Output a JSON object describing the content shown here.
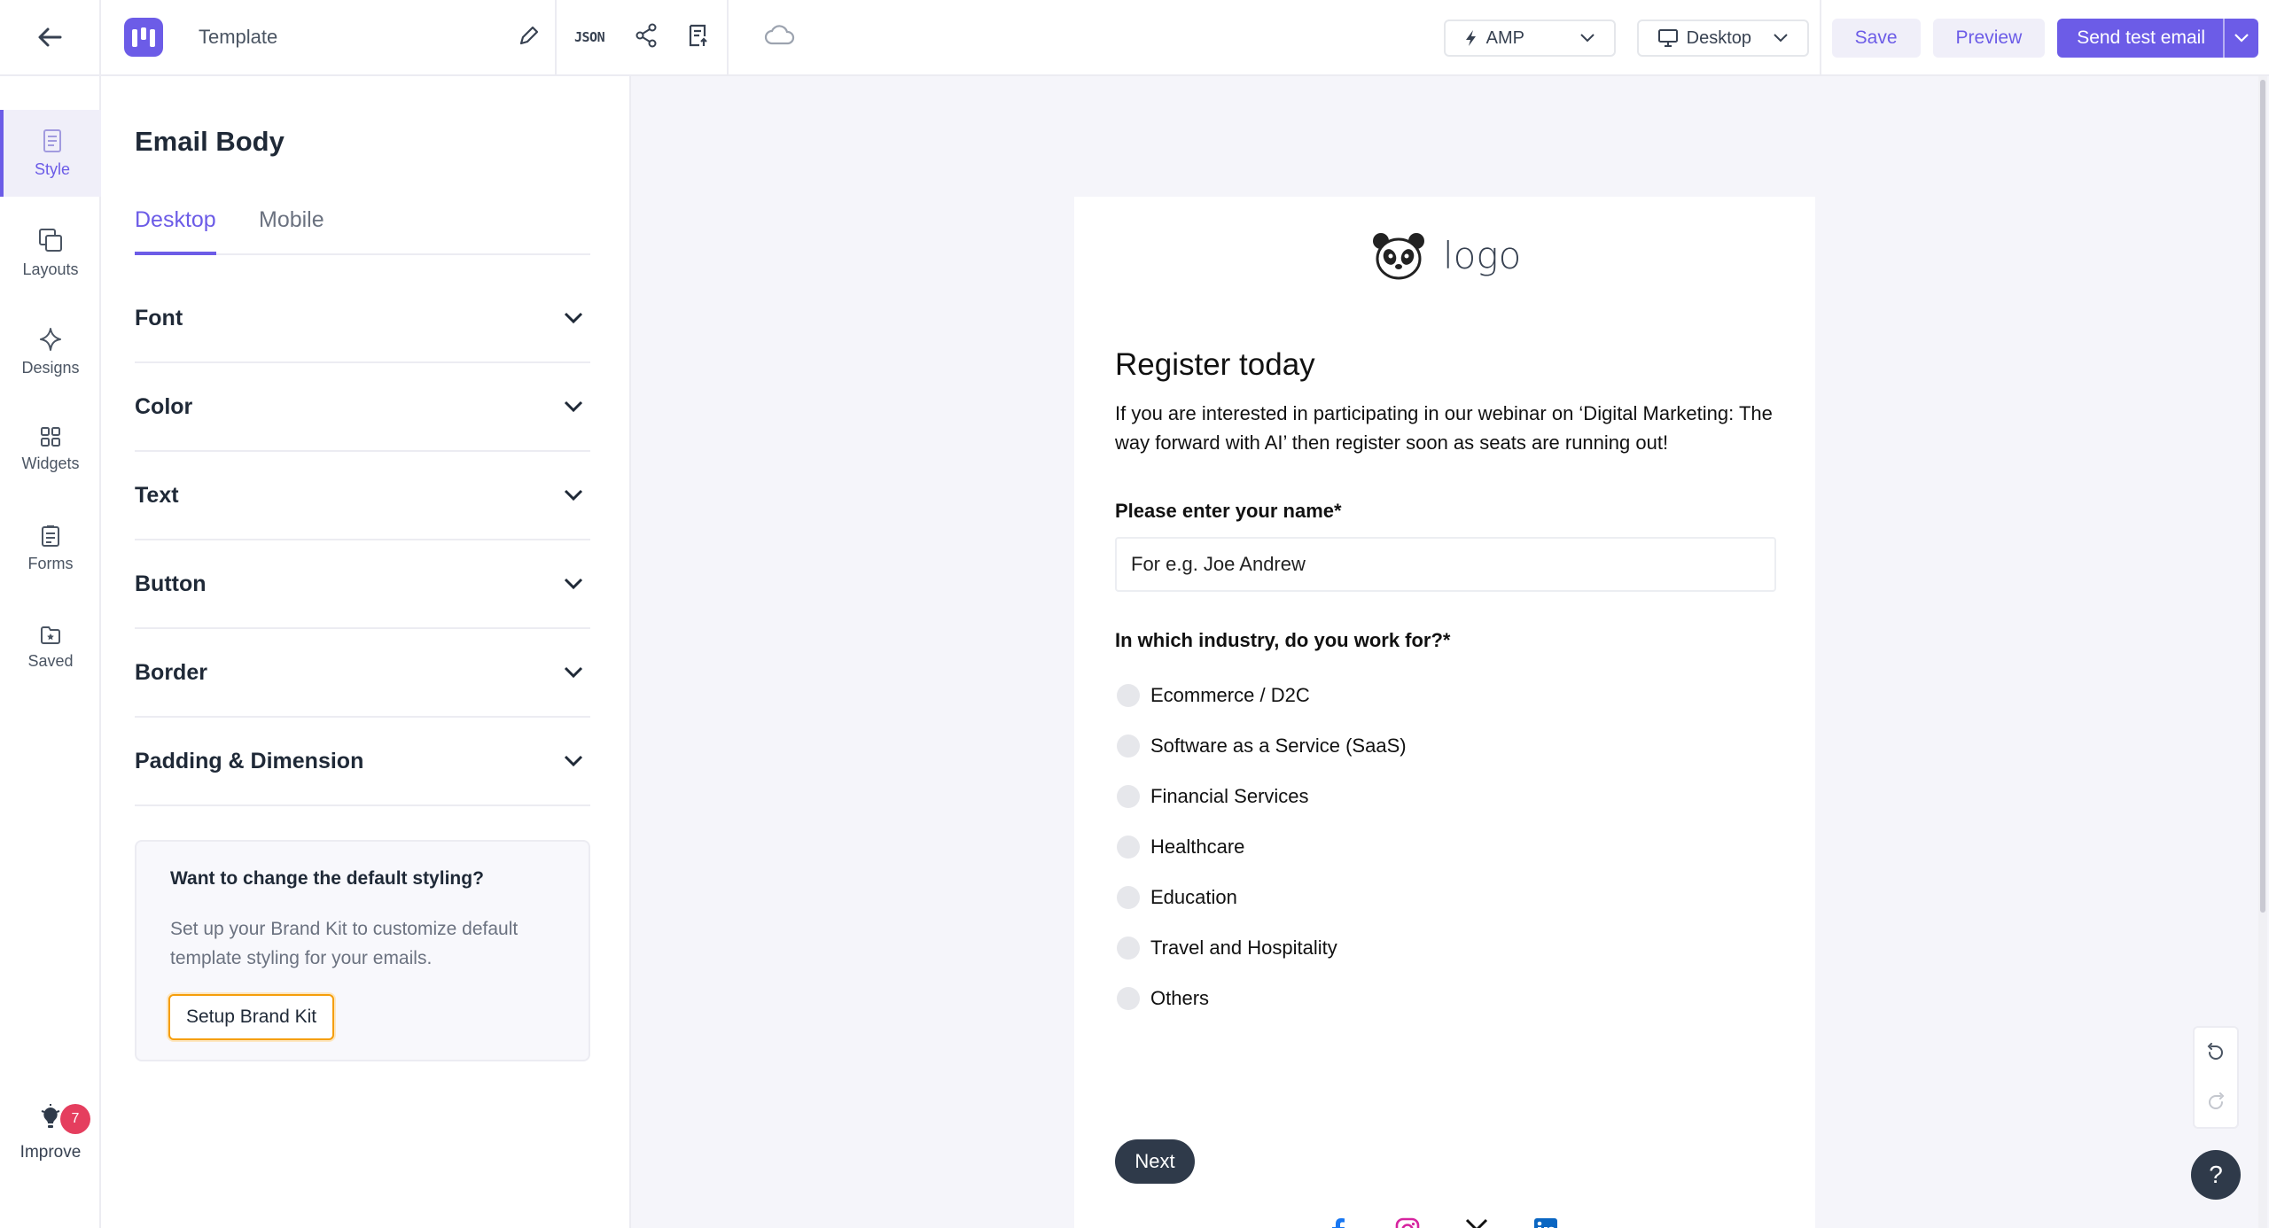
{
  "topbar": {
    "template_title": "Template",
    "json_label": "JSON",
    "amp_label": "AMP",
    "device_label": "Desktop",
    "save_label": "Save",
    "preview_label": "Preview",
    "send_label": "Send test email"
  },
  "rail": {
    "items": [
      {
        "label": "Style",
        "icon": "style-icon"
      },
      {
        "label": "Layouts",
        "icon": "layouts-icon"
      },
      {
        "label": "Designs",
        "icon": "designs-icon"
      },
      {
        "label": "Widgets",
        "icon": "widgets-icon"
      },
      {
        "label": "Forms",
        "icon": "forms-icon"
      },
      {
        "label": "Saved",
        "icon": "saved-icon"
      }
    ],
    "improve_label": "Improve",
    "improve_badge": "7"
  },
  "panel": {
    "title": "Email Body",
    "tabs": [
      {
        "label": "Desktop"
      },
      {
        "label": "Mobile"
      }
    ],
    "sections": [
      {
        "label": "Font"
      },
      {
        "label": "Color"
      },
      {
        "label": "Text"
      },
      {
        "label": "Button"
      },
      {
        "label": "Border"
      },
      {
        "label": "Padding & Dimension"
      }
    ],
    "brand_kit": {
      "title": "Want to change the default styling?",
      "description": "Set up your Brand Kit to customize default template styling for your emails.",
      "button": "Setup Brand Kit"
    }
  },
  "email": {
    "logo_text": "logo",
    "heading": "Register today",
    "intro": "If you are interested in participating in our webinar on ‘Digital Marketing: The way forward with AI’ then register soon as seats are running out!",
    "name_label": "Please enter your name*",
    "name_placeholder": "For e.g. Joe Andrew",
    "industry_label": "In which industry, do you work for?*",
    "options": [
      "Ecommerce / D2C",
      "Software as a Service (SaaS)",
      "Financial Services",
      "Healthcare",
      "Education",
      "Travel and Hospitality",
      "Others"
    ],
    "next_label": "Next",
    "social": [
      "facebook-icon",
      "instagram-icon",
      "x-icon",
      "linkedin-icon"
    ]
  },
  "help_label": "?",
  "colors": {
    "accent": "#6c5ce7",
    "badge": "#e53e5e",
    "dark_button": "#2f3a4a"
  }
}
